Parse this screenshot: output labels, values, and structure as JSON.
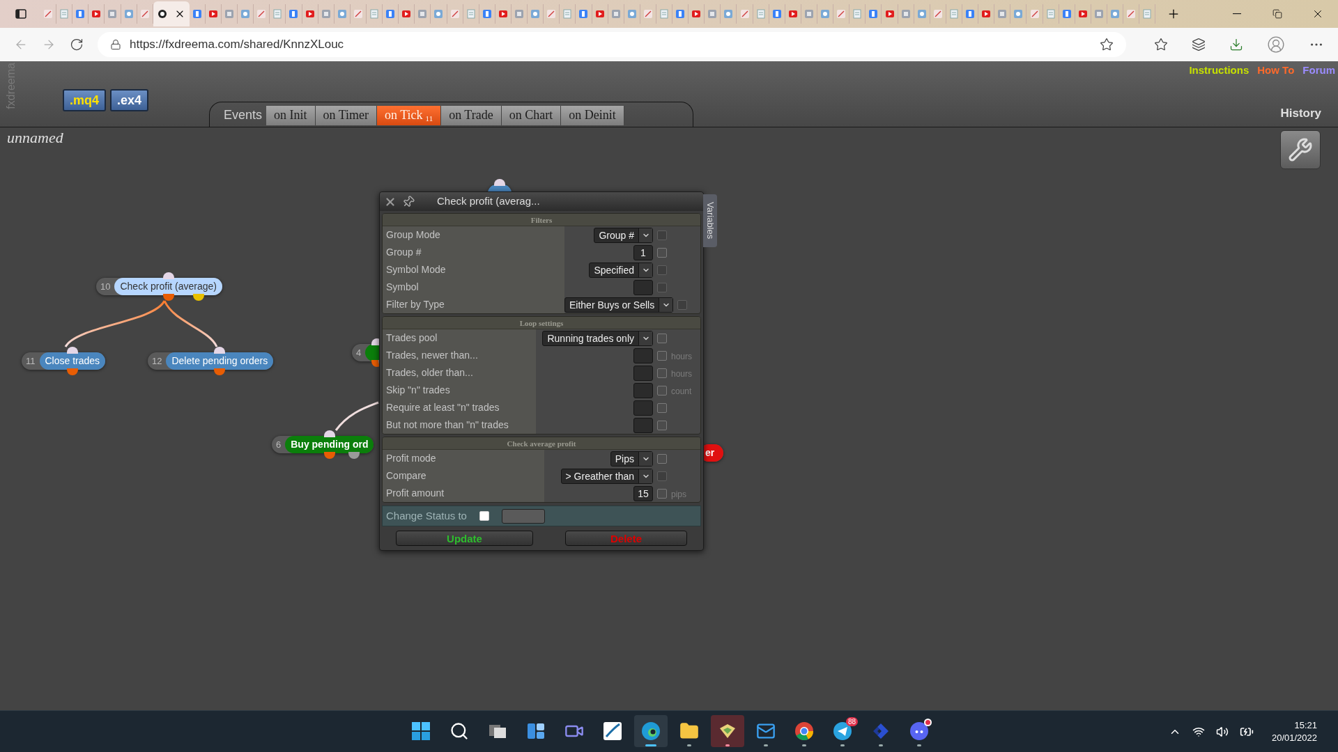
{
  "browser": {
    "tabs": [
      {
        "selected": false
      },
      {
        "selected": false
      },
      {
        "selected": false
      },
      {
        "selected": false
      },
      {
        "selected": false
      },
      {
        "selected": false
      },
      {
        "selected": false
      },
      {
        "selected": true
      },
      {
        "selected": false
      },
      {
        "selected": false
      },
      {
        "selected": false
      },
      {
        "selected": false
      },
      {
        "selected": false
      },
      {
        "selected": false
      },
      {
        "selected": false
      },
      {
        "selected": false
      },
      {
        "selected": false
      },
      {
        "selected": false
      },
      {
        "selected": false
      },
      {
        "selected": false
      },
      {
        "selected": false
      },
      {
        "selected": false
      },
      {
        "selected": false
      },
      {
        "selected": false
      },
      {
        "selected": false
      },
      {
        "selected": false
      },
      {
        "selected": false
      },
      {
        "selected": false
      },
      {
        "selected": false
      },
      {
        "selected": false
      },
      {
        "selected": false
      },
      {
        "selected": false
      },
      {
        "selected": false
      },
      {
        "selected": false
      },
      {
        "selected": false
      },
      {
        "selected": false
      },
      {
        "selected": false
      },
      {
        "selected": false
      },
      {
        "selected": false
      },
      {
        "selected": false
      },
      {
        "selected": false
      },
      {
        "selected": false
      },
      {
        "selected": false
      },
      {
        "selected": false
      },
      {
        "selected": false
      },
      {
        "selected": false
      },
      {
        "selected": false
      },
      {
        "selected": false
      },
      {
        "selected": false
      },
      {
        "selected": false
      },
      {
        "selected": false
      },
      {
        "selected": false
      },
      {
        "selected": false
      },
      {
        "selected": false
      },
      {
        "selected": false
      },
      {
        "selected": false
      },
      {
        "selected": false
      },
      {
        "selected": false
      },
      {
        "selected": false
      },
      {
        "selected": false
      },
      {
        "selected": false
      },
      {
        "selected": false
      },
      {
        "selected": false
      },
      {
        "selected": false
      },
      {
        "selected": false
      },
      {
        "selected": false
      },
      {
        "selected": false
      },
      {
        "selected": false
      }
    ],
    "url": "https://fxdreema.com/shared/KnnzXLouc"
  },
  "header": {
    "brand": "fxdreema",
    "export_buttons": [
      {
        "label": ".mq4",
        "kind": "source"
      },
      {
        "label": ".ex4",
        "kind": "compiled"
      }
    ],
    "links": [
      {
        "label": "Instructions",
        "color": "#c6e000"
      },
      {
        "label": "How To",
        "color": "#ff6a2b"
      },
      {
        "label": "Forum",
        "color": "#9b8cff"
      }
    ],
    "events_label": "Events",
    "event_tabs": [
      {
        "label": "on Init",
        "selected": false
      },
      {
        "label": "on Timer",
        "selected": false
      },
      {
        "label": "on Tick",
        "badge": "11",
        "selected": true
      },
      {
        "label": "on Trade",
        "selected": false
      },
      {
        "label": "on Chart",
        "selected": false
      },
      {
        "label": "on Deinit",
        "selected": false
      }
    ],
    "history": "History",
    "project_name": "unnamed"
  },
  "canvas": {
    "nodes": [
      {
        "number": "10",
        "label": "Check profit (average)",
        "kind": "condition"
      },
      {
        "number": "11",
        "label": "Close trades",
        "kind": "action"
      },
      {
        "number": "12",
        "label": "Delete pending orders",
        "kind": "action"
      },
      {
        "number": "4",
        "kind": "trade"
      },
      {
        "number": "6",
        "label": "Buy pending ord",
        "kind": "trade"
      },
      {
        "label": "er",
        "kind": "alert"
      },
      {
        "kind": "action"
      }
    ]
  },
  "dialog": {
    "title": "Check profit (averag...",
    "side_tab": "Variables",
    "sections": [
      {
        "title": "Filters",
        "rows": [
          {
            "label": "Group Mode",
            "kind": "select",
            "value": "Group #",
            "checkbox": {
              "checked": false,
              "disabled": true
            }
          },
          {
            "label": "Group #",
            "kind": "input",
            "value": "1",
            "checkbox": {
              "checked": false,
              "disabled": false
            }
          },
          {
            "label": "Symbol Mode",
            "kind": "select",
            "value": "Specified",
            "checkbox": {
              "checked": false,
              "disabled": true
            }
          },
          {
            "label": "Symbol",
            "kind": "input",
            "checkbox": {
              "checked": false,
              "disabled": true
            }
          },
          {
            "label": "Filter by Type",
            "kind": "select",
            "value": "Either Buys or Sells",
            "checkbox": {
              "checked": false,
              "disabled": true
            }
          }
        ]
      },
      {
        "title": "Loop settings",
        "rows": [
          {
            "label": "Trades pool",
            "kind": "select",
            "value": "Running trades only",
            "checkbox": {
              "checked": false,
              "disabled": false
            }
          },
          {
            "label": "Trades, newer than...",
            "kind": "input",
            "unit": "hours",
            "checkbox": {
              "checked": false,
              "disabled": false
            }
          },
          {
            "label": "Trades, older than...",
            "kind": "input",
            "unit": "hours",
            "checkbox": {
              "checked": false,
              "disabled": false
            }
          },
          {
            "label": "Skip \"n\" trades",
            "kind": "input",
            "unit": "count",
            "checkbox": {
              "checked": false,
              "disabled": false
            }
          },
          {
            "label": "Require at least \"n\" trades",
            "kind": "input",
            "checkbox": {
              "checked": false,
              "disabled": false
            }
          },
          {
            "label": "But not more than \"n\" trades",
            "kind": "input",
            "checkbox": {
              "checked": false,
              "disabled": false
            }
          }
        ]
      },
      {
        "title": "Check average profit",
        "rows": [
          {
            "label": "Profit mode",
            "kind": "select",
            "value": "Pips",
            "checkbox": {
              "checked": false,
              "disabled": false
            }
          },
          {
            "label": "Compare",
            "kind": "select",
            "value": "> Greather than",
            "checkbox": {
              "checked": false,
              "disabled": true
            }
          },
          {
            "label": "Profit amount",
            "kind": "input",
            "value": "15",
            "unit": "pips",
            "checkbox": {
              "checked": false,
              "disabled": false
            }
          }
        ]
      }
    ],
    "status": {
      "label": "Change Status to",
      "checked": false
    },
    "buttons": [
      {
        "label": "Update",
        "kind": "update"
      },
      {
        "label": "Delete",
        "kind": "delete"
      }
    ]
  },
  "taskbar": {
    "apps": [
      {
        "kind": "start",
        "running": false,
        "selected": false,
        "attention": false
      },
      {
        "kind": "search",
        "running": false,
        "selected": false,
        "attention": false
      },
      {
        "kind": "taskview",
        "running": false,
        "selected": false,
        "attention": false
      },
      {
        "kind": "widgets",
        "running": false,
        "selected": false,
        "attention": false
      },
      {
        "kind": "chat",
        "running": false,
        "selected": false,
        "attention": false
      },
      {
        "kind": "slash",
        "running": false,
        "selected": false,
        "attention": false
      },
      {
        "kind": "edge",
        "running": true,
        "selected": true,
        "attention": false
      },
      {
        "kind": "folder",
        "running": true,
        "selected": false,
        "attention": false
      },
      {
        "kind": "book",
        "running": true,
        "selected": false,
        "attention": true
      },
      {
        "kind": "mail",
        "running": true,
        "selected": false,
        "attention": false
      },
      {
        "kind": "chrome",
        "running": true,
        "selected": false,
        "attention": false
      },
      {
        "kind": "telegram",
        "running": true,
        "selected": false,
        "attention": false,
        "badge": "88"
      },
      {
        "kind": "arrows",
        "running": true,
        "selected": false,
        "attention": false
      },
      {
        "kind": "discord",
        "running": true,
        "selected": false,
        "attention": false,
        "dot": true
      }
    ],
    "time": "15:21",
    "date": "20/01/2022"
  }
}
